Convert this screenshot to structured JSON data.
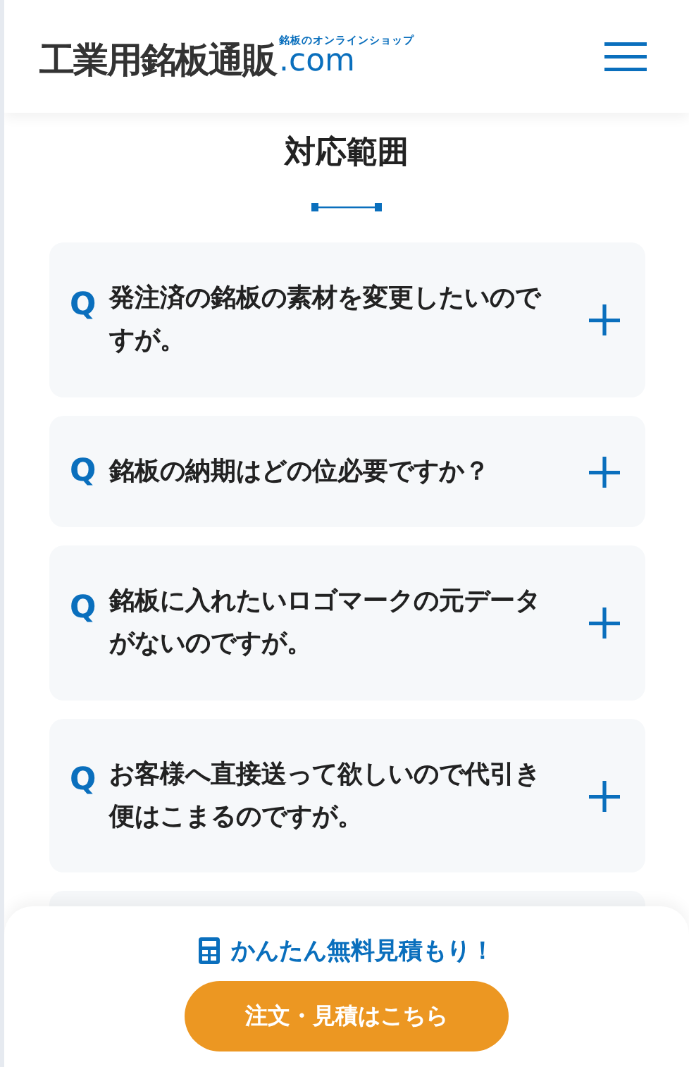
{
  "header": {
    "logo": {
      "main": "工業用銘板通販",
      "domain": ".com",
      "tagline": "銘板のオンラインショップ"
    }
  },
  "section": {
    "title": "対応範囲"
  },
  "faq": [
    {
      "mark": "Q",
      "question": "発注済の銘板の素材を変更したいのですが。",
      "expanded": false
    },
    {
      "mark": "Q",
      "question": "銘板の納期はどの位必要ですか？",
      "expanded": false
    },
    {
      "mark": "Q",
      "question": "銘板に入れたいロゴマークの元データがないのですが。",
      "expanded": false
    },
    {
      "mark": "Q",
      "question": "お客様へ直接送って欲しいので代引き便はこまるのですが。",
      "expanded": false
    }
  ],
  "footer_bar": {
    "estimate_link": "かんたん無料見積もり！",
    "order_button": "注文・見積はこちら"
  }
}
